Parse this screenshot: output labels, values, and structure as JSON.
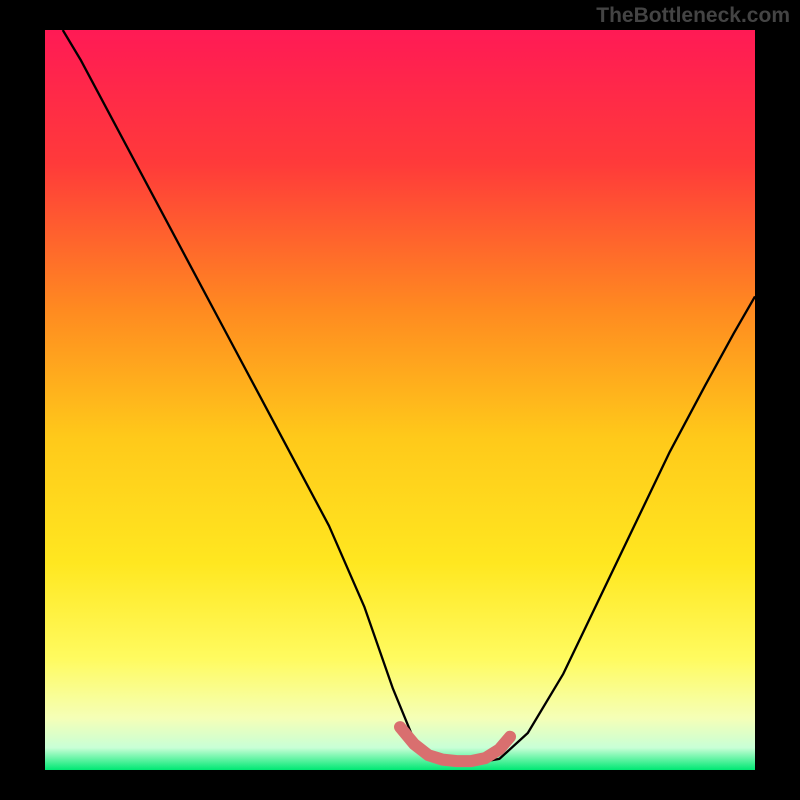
{
  "attribution": "TheBottleneck.com",
  "chart_data": {
    "type": "line",
    "title": "",
    "xlabel": "",
    "ylabel": "",
    "xlim": [
      0,
      1
    ],
    "ylim": [
      0,
      1
    ],
    "background_gradient": {
      "stops": [
        {
          "offset": 0.0,
          "color": "#ff1a55"
        },
        {
          "offset": 0.18,
          "color": "#ff3a3a"
        },
        {
          "offset": 0.38,
          "color": "#ff8b20"
        },
        {
          "offset": 0.55,
          "color": "#ffc91a"
        },
        {
          "offset": 0.72,
          "color": "#ffe720"
        },
        {
          "offset": 0.85,
          "color": "#fffb60"
        },
        {
          "offset": 0.93,
          "color": "#f5ffb7"
        },
        {
          "offset": 0.97,
          "color": "#c8ffd6"
        },
        {
          "offset": 1.0,
          "color": "#00e874"
        }
      ]
    },
    "series": [
      {
        "name": "curve",
        "stroke": "#000000",
        "stroke_width": 2.3,
        "x": [
          0.025,
          0.05,
          0.1,
          0.15,
          0.2,
          0.25,
          0.3,
          0.35,
          0.4,
          0.45,
          0.49,
          0.52,
          0.55,
          0.58,
          0.61,
          0.64,
          0.68,
          0.73,
          0.78,
          0.83,
          0.88,
          0.93,
          0.97,
          1.0
        ],
        "y": [
          1.0,
          0.96,
          0.87,
          0.78,
          0.69,
          0.6,
          0.51,
          0.42,
          0.33,
          0.22,
          0.11,
          0.04,
          0.015,
          0.01,
          0.01,
          0.015,
          0.05,
          0.13,
          0.23,
          0.33,
          0.43,
          0.52,
          0.59,
          0.64
        ]
      },
      {
        "name": "flat-highlight",
        "stroke": "#d96f6f",
        "stroke_width": 12,
        "linecap": "round",
        "x": [
          0.5,
          0.52,
          0.54,
          0.56,
          0.58,
          0.6,
          0.62,
          0.64,
          0.655
        ],
        "y": [
          0.058,
          0.035,
          0.02,
          0.014,
          0.012,
          0.012,
          0.016,
          0.028,
          0.045
        ]
      }
    ]
  }
}
